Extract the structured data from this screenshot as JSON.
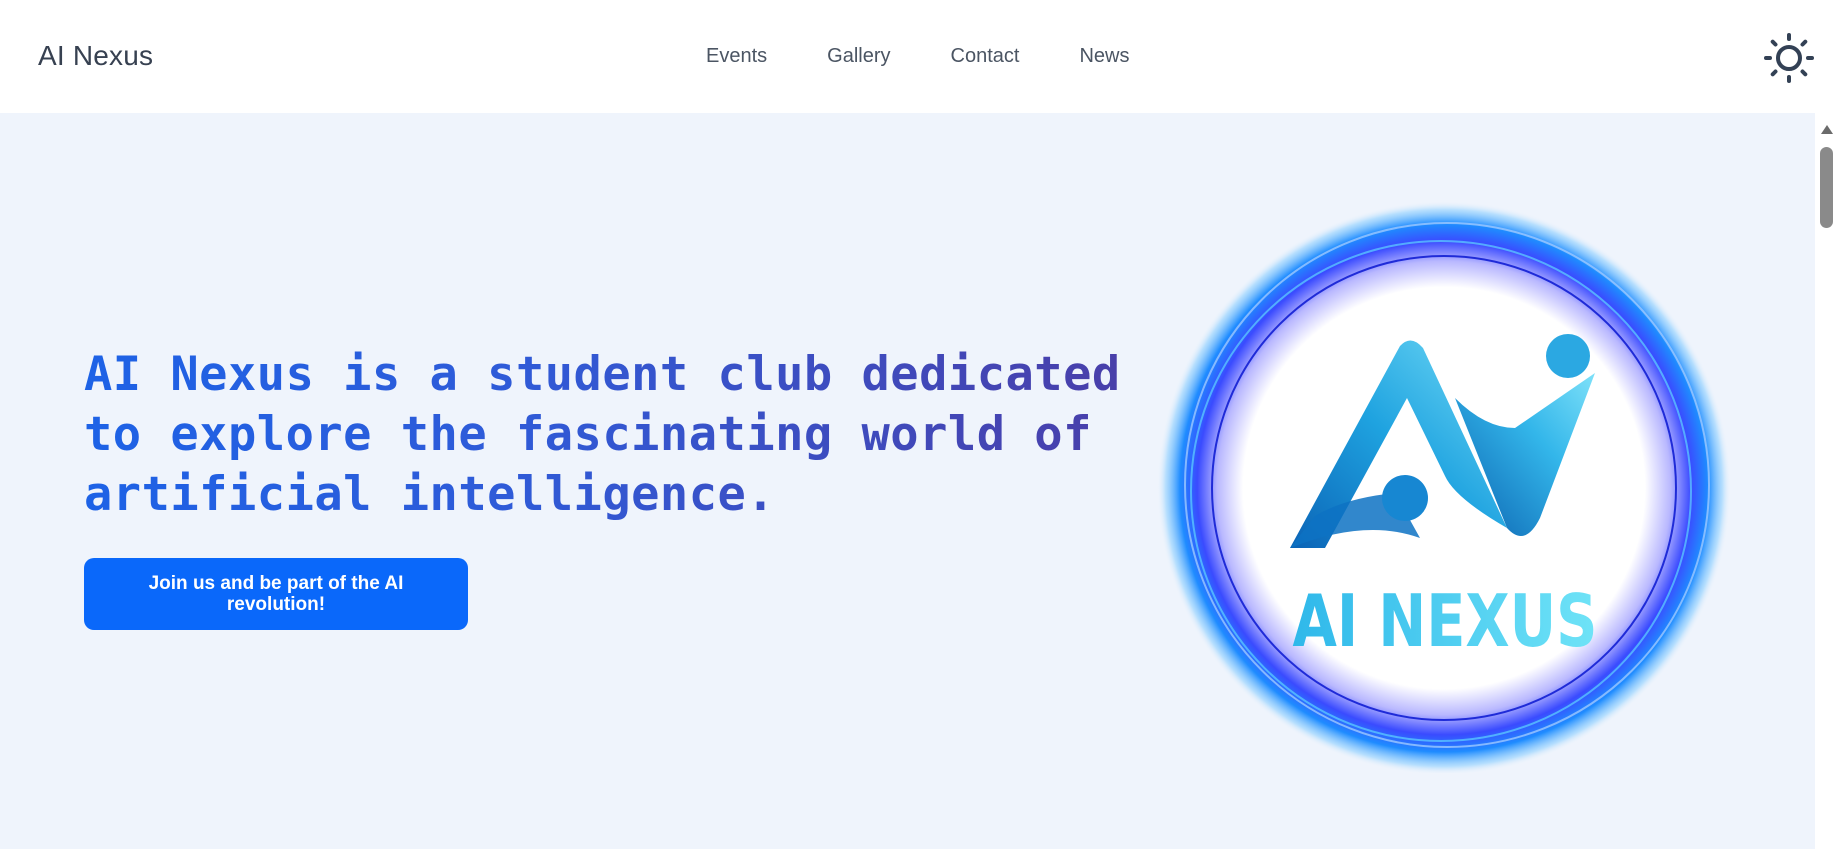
{
  "brand": {
    "name": "AI Nexus"
  },
  "nav": {
    "items": [
      {
        "label": "Events"
      },
      {
        "label": "Gallery"
      },
      {
        "label": "Contact"
      },
      {
        "label": "News"
      }
    ],
    "theme_toggle_icon": "sun-icon"
  },
  "hero": {
    "heading": "AI Nexus is a student club dedicated to explore the fascinating world of artificial intelligence.",
    "cta_label": "Join us and be part of the AI revolution!",
    "logo": {
      "text": "AI NEXUS",
      "icon": "ai-nexus-logo"
    }
  },
  "colors": {
    "hero_background": "#eff4fc",
    "cta_background": "#0a68fa",
    "heading_gradient_start": "#1d62e6",
    "heading_gradient_end": "#4a3ea8",
    "logo_glow": "#2f55ff",
    "logo_text": "#49c6f0"
  }
}
